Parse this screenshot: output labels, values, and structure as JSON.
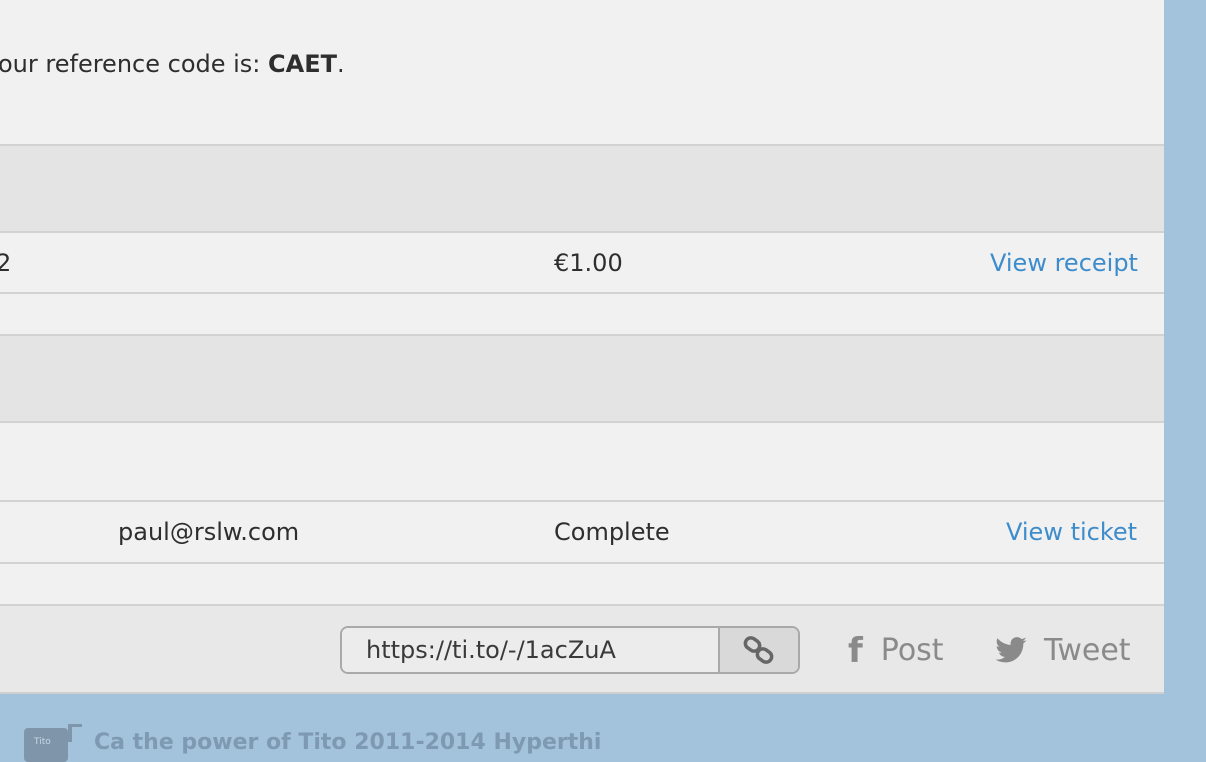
{
  "reference": {
    "prefix": "our reference code is: ",
    "code": "CAET",
    "suffix": "."
  },
  "payment_row": {
    "cut_text": "2",
    "amount": "€1.00",
    "receipt_link": "View receipt"
  },
  "ticket_row": {
    "email": "paul@rslw.com",
    "status": "Complete",
    "ticket_link": "View ticket"
  },
  "share": {
    "url": "https://ti.to/-/1acZuA",
    "post_label": "Post",
    "tweet_label": "Tweet"
  },
  "footer": {
    "logo_text": "Tito",
    "text": "Ca the power of Tito 2011-2014 Hyperthi"
  },
  "icons": {
    "copy": "link-icon",
    "facebook": "facebook-icon",
    "twitter": "twitter-icon",
    "logo": "tito-logo-icon"
  },
  "colors": {
    "link": "#3d8ccb",
    "background": "#a3c2db",
    "panel": "#f1f1f1"
  }
}
